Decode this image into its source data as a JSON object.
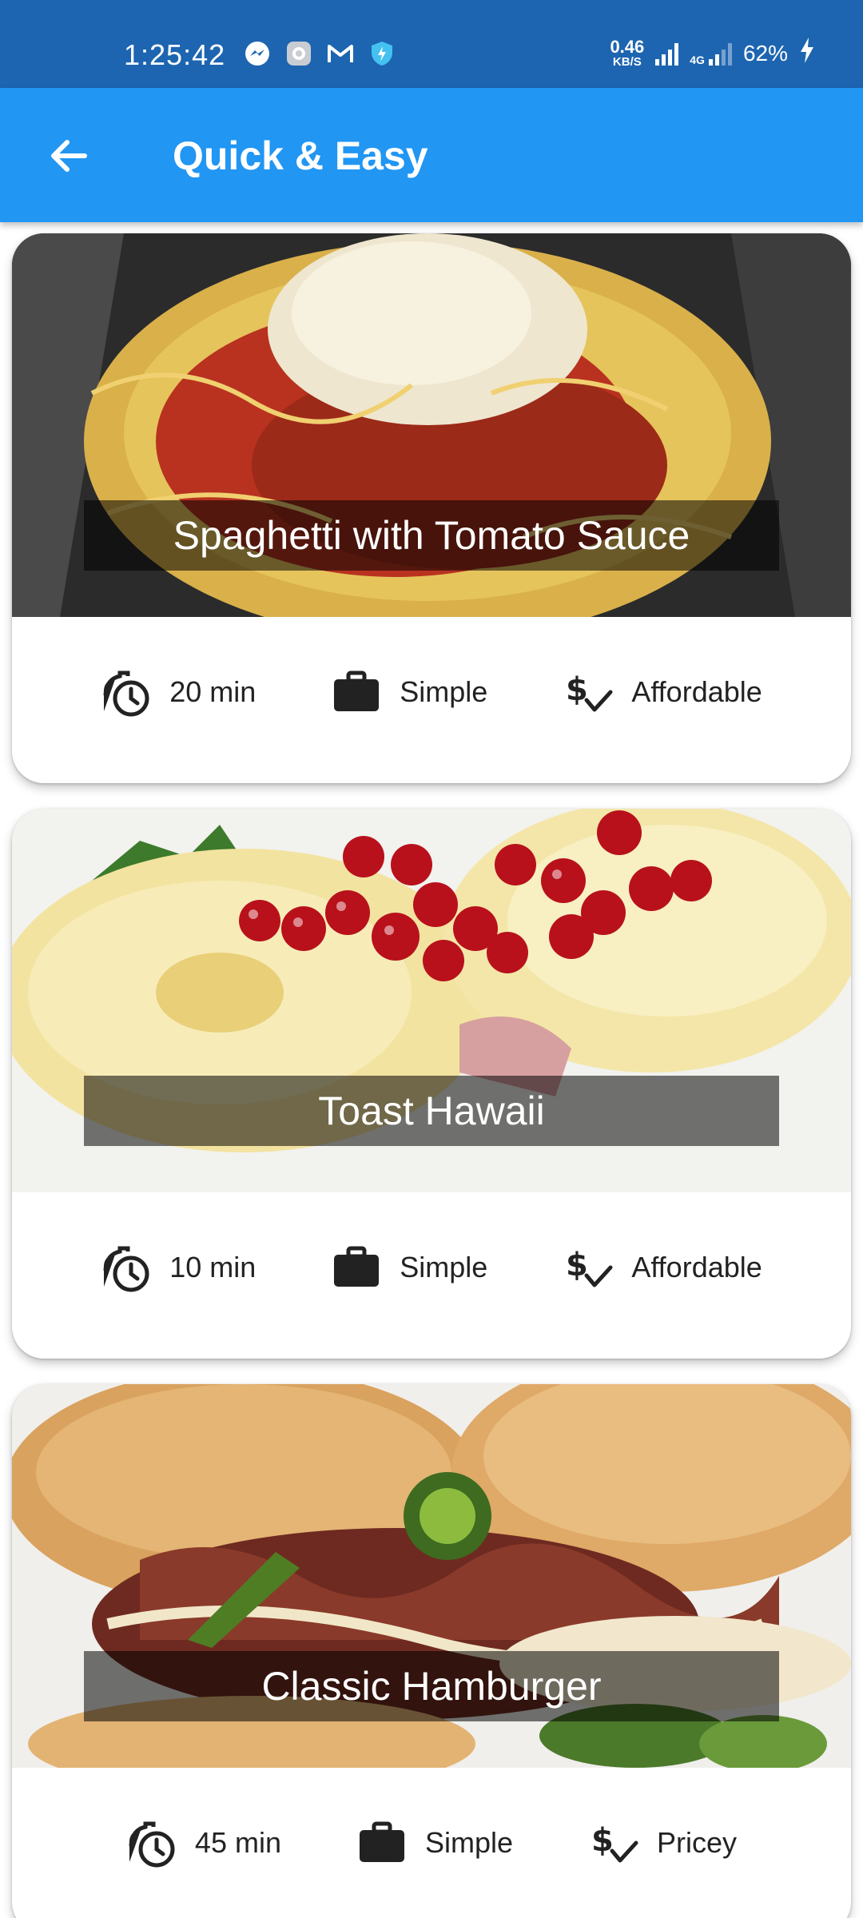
{
  "status_bar": {
    "time": "1:25:42",
    "net_speed_value": "0.46",
    "net_speed_unit": "KB/S",
    "network_type": "4G",
    "battery": "62%"
  },
  "app_bar": {
    "title": "Quick & Easy"
  },
  "colors": {
    "status_bar_bg": "#1d65b0",
    "app_bar_bg": "#2196f3",
    "card_bg": "#ffffff",
    "title_band_bg": "rgba(0,0,0,0.54)"
  },
  "recipes": [
    {
      "title": "Spaghetti with Tomato Sauce",
      "duration": "20 min",
      "complexity": "Simple",
      "affordability": "Affordable"
    },
    {
      "title": "Toast Hawaii",
      "duration": "10 min",
      "complexity": "Simple",
      "affordability": "Affordable"
    },
    {
      "title": "Classic Hamburger",
      "duration": "45 min",
      "complexity": "Simple",
      "affordability": "Pricey"
    }
  ]
}
